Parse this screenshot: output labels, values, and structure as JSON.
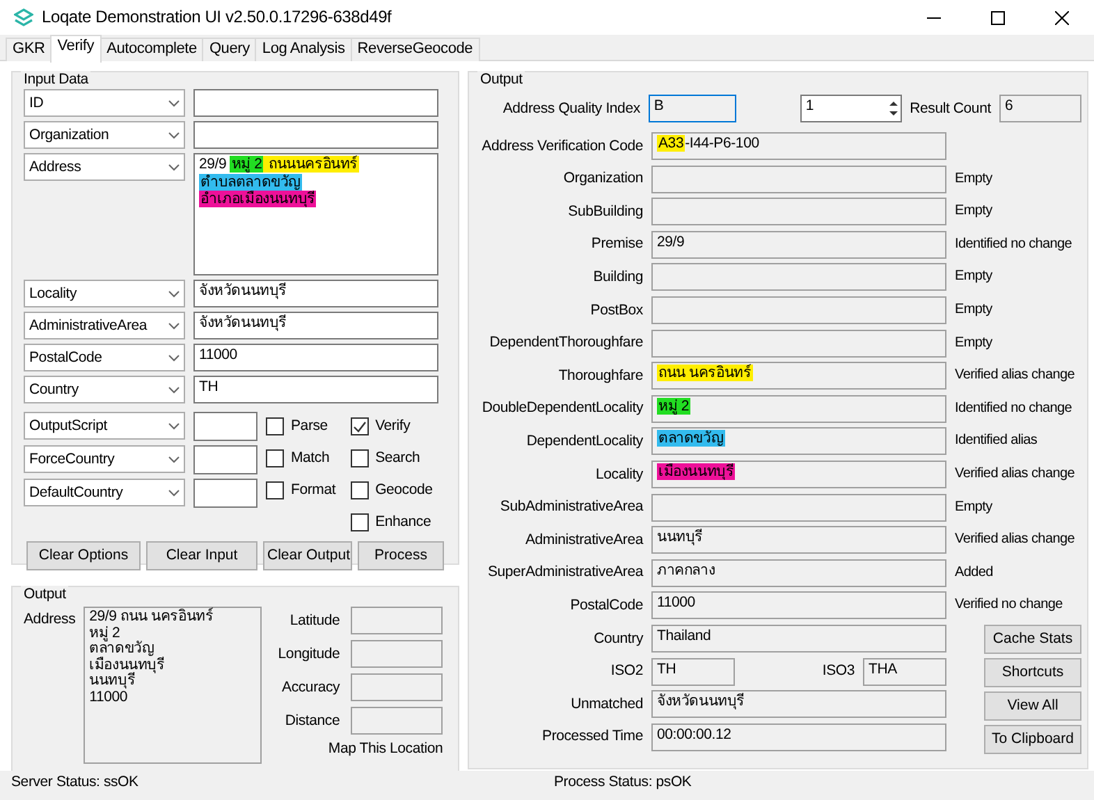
{
  "window": {
    "title": "Loqate Demonstration UI v2.50.0.17296-638d49f"
  },
  "tabs": [
    {
      "label": "GKR",
      "selected": false
    },
    {
      "label": "Verify",
      "selected": true
    },
    {
      "label": "Autocomplete",
      "selected": false
    },
    {
      "label": "Query",
      "selected": false
    },
    {
      "label": "Log Analysis",
      "selected": false
    },
    {
      "label": "ReverseGeocode",
      "selected": false
    }
  ],
  "input_data": {
    "title": "Input Data",
    "rows": [
      {
        "field": "ID",
        "kind": "line"
      },
      {
        "field": "Organization",
        "kind": "line"
      },
      {
        "field": "Address",
        "kind": "multiline",
        "lines": [
          [
            {
              "text": "29/9 "
            },
            {
              "text": "หมู่ 2",
              "color": "#22dd22"
            },
            {
              "text": " ถนนนครอินทร์",
              "color": "#ffee00"
            }
          ],
          [
            {
              "text": "ตำบลตลาดขวัญ",
              "color": "#33bbee"
            }
          ],
          [
            {
              "text": "อำเภอเมืองนนทบุรี",
              "color": "#ee1199"
            }
          ]
        ]
      },
      {
        "field": "Locality",
        "kind": "line",
        "value": "จังหวัดนนทบุรี"
      },
      {
        "field": "AdministrativeArea",
        "kind": "line",
        "value": "จังหวัดนนทบุรี"
      },
      {
        "field": "PostalCode",
        "kind": "line",
        "value": "11000"
      },
      {
        "field": "Country",
        "kind": "line",
        "value": "TH"
      }
    ],
    "options": [
      {
        "field": "OutputScript"
      },
      {
        "field": "ForceCountry"
      },
      {
        "field": "DefaultCountry"
      }
    ],
    "checkbox_columns": [
      [
        {
          "label": "Parse",
          "checked": false
        },
        {
          "label": "Match",
          "checked": false
        },
        {
          "label": "Format",
          "checked": false
        }
      ],
      [
        {
          "label": "Verify",
          "checked": true
        },
        {
          "label": "Search",
          "checked": false
        },
        {
          "label": "Geocode",
          "checked": false
        },
        {
          "label": "Enhance",
          "checked": false
        }
      ]
    ],
    "buttons": [
      "Clear Options",
      "Clear Input",
      "Clear Output",
      "Process"
    ]
  },
  "output_left": {
    "title": "Output",
    "address_label": "Address",
    "address_lines": [
      "29/9 ถนน นครอินทร์",
      "หมู่ 2",
      "ตลาดขวัญ",
      "เมืองนนทบุรี",
      "นนทบุรี",
      "11000"
    ],
    "geo_fields": [
      "Latitude",
      "Longitude",
      "Accuracy",
      "Distance"
    ],
    "map_link": "Map This Location"
  },
  "output_right": {
    "title": "Output",
    "quality_label": "Address Quality Index",
    "quality_value": "B",
    "spinner_value": "1",
    "result_count_label": "Result Count",
    "result_count": "6",
    "fields": [
      {
        "kind": "field",
        "label": "Address Verification Code",
        "value": [
          {
            "text": "A33",
            "color": "#ffee00"
          },
          {
            "text": "-I44-P6-100"
          }
        ]
      },
      {
        "kind": "field",
        "label": "Organization",
        "status": "Empty"
      },
      {
        "kind": "field",
        "label": "SubBuilding",
        "status": "Empty"
      },
      {
        "kind": "field",
        "label": "Premise",
        "value": [
          {
            "text": "29/9"
          }
        ],
        "status": "Identified no change"
      },
      {
        "kind": "field",
        "label": "Building",
        "status": "Empty"
      },
      {
        "kind": "field",
        "label": "PostBox",
        "status": "Empty"
      },
      {
        "kind": "field",
        "label": "DependentThoroughfare",
        "status": "Empty"
      },
      {
        "kind": "field",
        "label": "Thoroughfare",
        "value": [
          {
            "text": "ถนน นครอินทร์",
            "color": "#ffee00"
          }
        ],
        "status": "Verified alias change"
      },
      {
        "kind": "field",
        "label": "DoubleDependentLocality",
        "value": [
          {
            "text": "หมู่ 2",
            "color": "#22dd22"
          }
        ],
        "status": "Identified no change"
      },
      {
        "kind": "field",
        "label": "DependentLocality",
        "value": [
          {
            "text": "ตลาดขวัญ",
            "color": "#33bbee"
          }
        ],
        "status": "Identified alias"
      },
      {
        "kind": "field",
        "label": "Locality",
        "value": [
          {
            "text": "เมืองนนทบุรี",
            "color": "#ee1199"
          }
        ],
        "status": "Verified alias change"
      },
      {
        "kind": "field",
        "label": "SubAdministrativeArea",
        "status": "Empty"
      },
      {
        "kind": "field",
        "label": "AdministrativeArea",
        "value": [
          {
            "text": "นนทบุรี"
          }
        ],
        "status": "Verified alias change"
      },
      {
        "kind": "field",
        "label": "SuperAdministrativeArea",
        "value": [
          {
            "text": "ภาคกลาง"
          }
        ],
        "status": "Added"
      },
      {
        "kind": "field",
        "label": "PostalCode",
        "value": [
          {
            "text": "11000"
          }
        ],
        "status": "Verified no change"
      },
      {
        "kind": "field",
        "label": "Country",
        "value": [
          {
            "text": "Thailand"
          }
        ]
      },
      {
        "kind": "iso",
        "label": "ISO2",
        "value": "TH",
        "label2": "ISO3",
        "value2": "THA"
      },
      {
        "kind": "field",
        "label": "Unmatched",
        "value": [
          {
            "text": "จังหวัดนนทบุรี"
          }
        ]
      },
      {
        "kind": "field",
        "label": "Processed Time",
        "value": [
          {
            "text": "00:00:00.12"
          }
        ]
      }
    ],
    "side_buttons": [
      "Cache Stats",
      "Shortcuts",
      "View All",
      "To Clipboard"
    ]
  },
  "status_bar": {
    "server": "Server Status: ssOK",
    "process": "Process Status: psOK"
  }
}
